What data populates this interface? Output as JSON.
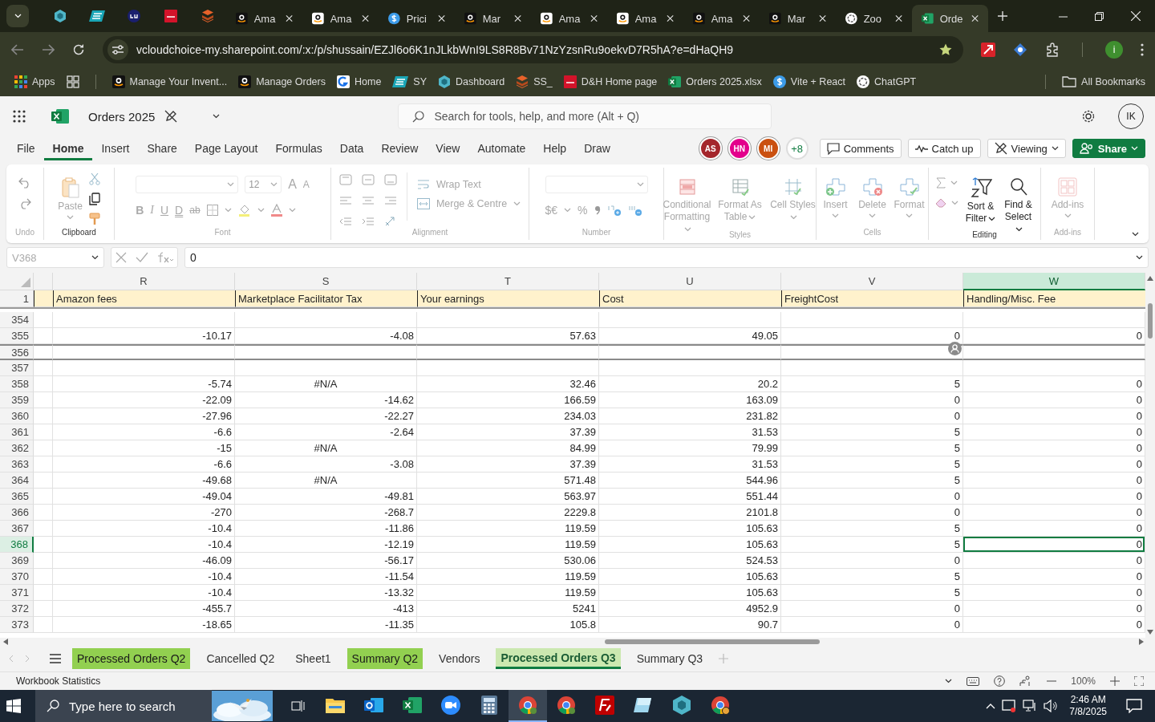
{
  "browser": {
    "tabs": [
      {
        "label": "Ama",
        "selected": false
      },
      {
        "label": "Ama",
        "selected": false
      },
      {
        "label": "Prici",
        "selected": false
      },
      {
        "label": "Mar",
        "selected": false
      },
      {
        "label": "Ama",
        "selected": false
      },
      {
        "label": "Ama",
        "selected": false
      },
      {
        "label": "Ama",
        "selected": false
      },
      {
        "label": "Mar",
        "selected": false
      },
      {
        "label": "Zoo",
        "selected": false
      },
      {
        "label": "Orde",
        "selected": true
      }
    ],
    "address": "vcloudchoice-my.sharepoint.com/:x:/p/shussain/EZJl6o6K1nJLkbWnI9LS8R8Bv71NzYzsnRu9oekvD7R5hA?e=dHaQH9",
    "profile": "i",
    "bookmarks": [
      {
        "label": "Apps"
      },
      {
        "label": "Manage Your Invent..."
      },
      {
        "label": "Manage Orders"
      },
      {
        "label": "Home"
      },
      {
        "label": "SY"
      },
      {
        "label": "Dashboard"
      },
      {
        "label": "SS_"
      },
      {
        "label": "D&H Home page"
      },
      {
        "label": "Orders 2025.xlsx"
      },
      {
        "label": "Vite + React"
      },
      {
        "label": "ChatGPT"
      }
    ],
    "all_bookmarks": "All Bookmarks"
  },
  "workbook": {
    "title": "Orders 2025",
    "search_placeholder": "Search for tools, help, and more (Alt + Q)",
    "account": "IK",
    "menu": [
      {
        "label": "File",
        "selected": false
      },
      {
        "label": "Home",
        "selected": true
      },
      {
        "label": "Insert",
        "selected": false
      },
      {
        "label": "Share",
        "selected": false
      },
      {
        "label": "Page Layout",
        "selected": false
      },
      {
        "label": "Formulas",
        "selected": false
      },
      {
        "label": "Data",
        "selected": false
      },
      {
        "label": "Review",
        "selected": false
      },
      {
        "label": "View",
        "selected": false
      },
      {
        "label": "Automate",
        "selected": false
      },
      {
        "label": "Help",
        "selected": false
      },
      {
        "label": "Draw",
        "selected": false
      }
    ],
    "collaborators": [
      {
        "initials": "AS",
        "color": "#a4262c"
      },
      {
        "initials": "HN",
        "color": "#e3008c"
      },
      {
        "initials": "MI",
        "color": "#ca5010"
      }
    ],
    "more_collaborators": "+8",
    "actions": [
      {
        "label": "Comments",
        "kind": "comments"
      },
      {
        "label": "Catch up",
        "kind": "catchup"
      },
      {
        "label": "Viewing",
        "kind": "mode"
      },
      {
        "label": "Share",
        "kind": "share"
      }
    ]
  },
  "ribbon": {
    "groups": [
      {
        "kind": "undo",
        "label": "Undo",
        "disabled": true
      },
      {
        "kind": "clipboard",
        "label": "Clipboard",
        "disabled": false,
        "buttons": [
          {
            "label": "Paste",
            "disabled": true
          }
        ]
      },
      {
        "kind": "font",
        "label": "Font",
        "disabled": true,
        "font_size": "12",
        "format_buttons": [
          "B",
          "I",
          "U",
          "D",
          "ab"
        ],
        "size_buttons": [
          "A",
          "A"
        ]
      },
      {
        "kind": "alignment",
        "label": "Alignment",
        "disabled": true,
        "buttons": [
          {
            "label": "Wrap Text",
            "disabled": true
          },
          {
            "label": "Merge & Centre",
            "disabled": true
          }
        ]
      },
      {
        "kind": "number",
        "label": "Number",
        "disabled": true,
        "symbols": [
          "$€",
          "%"
        ]
      },
      {
        "kind": "styles",
        "label": "Styles",
        "disabled": true,
        "buttons": [
          {
            "label": "Conditional Formatting",
            "disabled": true
          },
          {
            "label": "Format As Table",
            "disabled": true
          },
          {
            "label": "Cell Styles",
            "disabled": true
          }
        ]
      },
      {
        "kind": "cells",
        "label": "Cells",
        "disabled": true,
        "buttons": [
          {
            "label": "Insert",
            "disabled": true
          },
          {
            "label": "Delete",
            "disabled": true
          },
          {
            "label": "Format",
            "disabled": true
          }
        ]
      },
      {
        "kind": "editing",
        "label": "Editing",
        "disabled": false,
        "buttons": [
          {
            "label": "Sort & Filter",
            "disabled": false
          },
          {
            "label": "Find & Select",
            "disabled": false
          }
        ]
      },
      {
        "kind": "addins",
        "label": "Add-ins",
        "disabled": true,
        "buttons": [
          {
            "label": "Add-ins",
            "disabled": true
          }
        ]
      }
    ]
  },
  "formula_bar": {
    "name_box": "V368",
    "value": "0"
  },
  "sheet": {
    "header_row": "1",
    "columns": [
      {
        "letter": "R",
        "header": "Amazon fees",
        "selected": false
      },
      {
        "letter": "S",
        "header": "Marketplace Facilitator Tax",
        "selected": false
      },
      {
        "letter": "T",
        "header": "Your earnings",
        "selected": false
      },
      {
        "letter": "U",
        "header": "Cost",
        "selected": false
      },
      {
        "letter": "V",
        "header": "FreightCost",
        "selected": false
      },
      {
        "letter": "W",
        "header": "Handling/Misc. Fee",
        "selected": true
      }
    ],
    "rows": [
      {
        "number": "354",
        "selected": false,
        "boundary": false
      },
      {
        "number": "355",
        "selected": false,
        "boundary": false,
        "cells": [
          "-10.17",
          "-4.08",
          "57.63",
          "49.05",
          "0",
          "0"
        ]
      },
      {
        "number": "356",
        "selected": false,
        "boundary": true
      },
      {
        "number": "357",
        "selected": false,
        "boundary": false
      },
      {
        "number": "358",
        "selected": false,
        "boundary": false,
        "cells": [
          "-5.74",
          {
            "text": "#N/A",
            "kind": "error"
          },
          "32.46",
          "20.2",
          "5",
          "0"
        ]
      },
      {
        "number": "359",
        "selected": false,
        "boundary": false,
        "cells": [
          "-22.09",
          "-14.62",
          "166.59",
          "163.09",
          "0",
          "0"
        ]
      },
      {
        "number": "360",
        "selected": false,
        "boundary": false,
        "cells": [
          "-27.96",
          "-22.27",
          "234.03",
          "231.82",
          "0",
          "0"
        ]
      },
      {
        "number": "361",
        "selected": false,
        "boundary": false,
        "cells": [
          "-6.6",
          "-2.64",
          "37.39",
          "31.53",
          "5",
          "0"
        ]
      },
      {
        "number": "362",
        "selected": false,
        "boundary": false,
        "cells": [
          "-15",
          {
            "text": "#N/A",
            "kind": "error"
          },
          "84.99",
          "79.99",
          "5",
          "0"
        ]
      },
      {
        "number": "363",
        "selected": false,
        "boundary": false,
        "cells": [
          "-6.6",
          "-3.08",
          "37.39",
          "31.53",
          "5",
          "0"
        ]
      },
      {
        "number": "364",
        "selected": false,
        "boundary": false,
        "cells": [
          "-49.68",
          {
            "text": "#N/A",
            "kind": "error"
          },
          "571.48",
          "544.96",
          "5",
          "0"
        ]
      },
      {
        "number": "365",
        "selected": false,
        "boundary": false,
        "cells": [
          "-49.04",
          "-49.81",
          "563.97",
          "551.44",
          "0",
          "0"
        ]
      },
      {
        "number": "366",
        "selected": false,
        "boundary": false,
        "cells": [
          "-270",
          "-268.7",
          "2229.8",
          "2101.8",
          "0",
          "0"
        ]
      },
      {
        "number": "367",
        "selected": false,
        "boundary": false,
        "cells": [
          "-10.4",
          "-11.86",
          "119.59",
          "105.63",
          "5",
          "0"
        ]
      },
      {
        "number": "368",
        "selected": true,
        "boundary": false,
        "cells": [
          "-10.4",
          "-12.19",
          "119.59",
          "105.63",
          "5",
          "0"
        ]
      },
      {
        "number": "369",
        "selected": false,
        "boundary": false,
        "cells": [
          "-46.09",
          "-56.17",
          "530.06",
          "524.53",
          "0",
          "0"
        ]
      },
      {
        "number": "370",
        "selected": false,
        "boundary": false,
        "cells": [
          "-10.4",
          "-11.54",
          "119.59",
          "105.63",
          "5",
          "0"
        ]
      },
      {
        "number": "371",
        "selected": false,
        "boundary": false,
        "cells": [
          "-10.4",
          "-13.32",
          "119.59",
          "105.63",
          "5",
          "0"
        ]
      },
      {
        "number": "372",
        "selected": false,
        "boundary": false,
        "cells": [
          "-455.7",
          "-413",
          "5241",
          "4952.9",
          "0",
          "0"
        ]
      },
      {
        "number": "373",
        "selected": false,
        "boundary": false,
        "cells": [
          "-18.65",
          "-11.35",
          "105.8",
          "90.7",
          "0",
          "0"
        ]
      }
    ]
  },
  "sheet_tabs": [
    {
      "label": "Processed Orders Q2",
      "selected": false,
      "color": "#92d050"
    },
    {
      "label": "Cancelled Q2",
      "selected": false
    },
    {
      "label": "Sheet1",
      "selected": false
    },
    {
      "label": "Summary Q2",
      "selected": false,
      "color": "#92d050"
    },
    {
      "label": "Vendors",
      "selected": false
    },
    {
      "label": "Processed Orders Q3",
      "selected": true,
      "color": "#cbe8b0"
    },
    {
      "label": "Summary Q3",
      "selected": false
    }
  ],
  "status_bar": {
    "text": "Workbook Statistics",
    "zoom": "100%"
  },
  "taskbar": {
    "search_placeholder": "Type here to search",
    "time": "2:46 AM",
    "date": "7/8/2025"
  }
}
